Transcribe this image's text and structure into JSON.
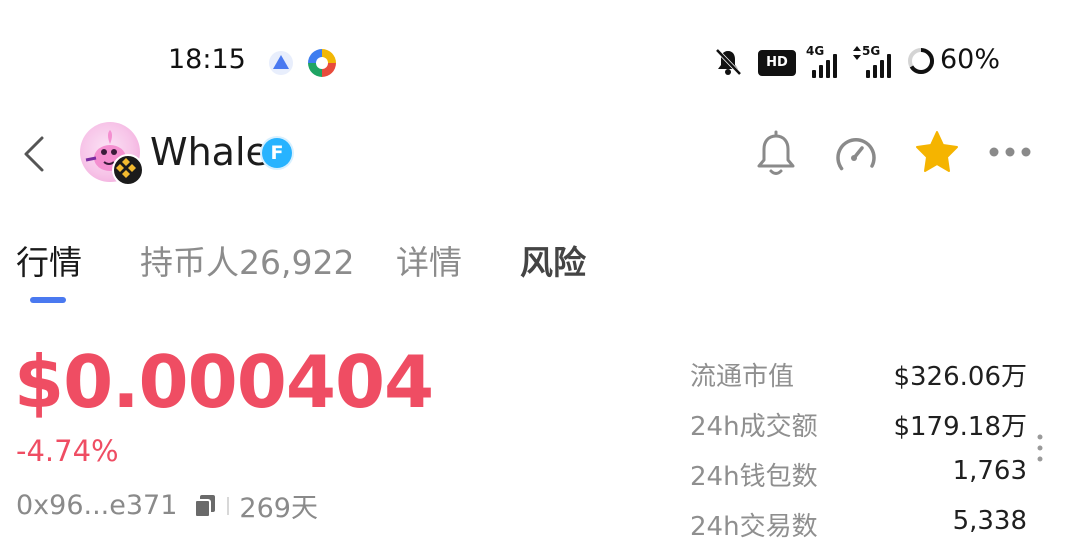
{
  "status_bar": {
    "time": "18:15",
    "network_1": "4G",
    "network_2": "5G",
    "hd_label": "HD",
    "battery": "60%"
  },
  "header": {
    "token_name": "Whale",
    "badge_letter": "F"
  },
  "tabs": [
    {
      "label": "行情",
      "active": true
    },
    {
      "label": "持币人26,922",
      "active": false
    },
    {
      "label": "详情",
      "active": false
    },
    {
      "label": "风险",
      "active": false
    }
  ],
  "price": {
    "value": "$0.000404",
    "change": "-4.74%",
    "address": "0x96...e371",
    "age": "269天"
  },
  "stats": [
    {
      "label": "流通市值",
      "value": "$326.06万"
    },
    {
      "label": "24h成交额",
      "value": "$179.18万"
    },
    {
      "label": "24h钱包数",
      "value": "1,763"
    },
    {
      "label": "24h交易数",
      "value": "5,338"
    }
  ],
  "colors": {
    "accent": "#4a79f0",
    "down": "#ef4d63",
    "star": "#f5b400"
  }
}
